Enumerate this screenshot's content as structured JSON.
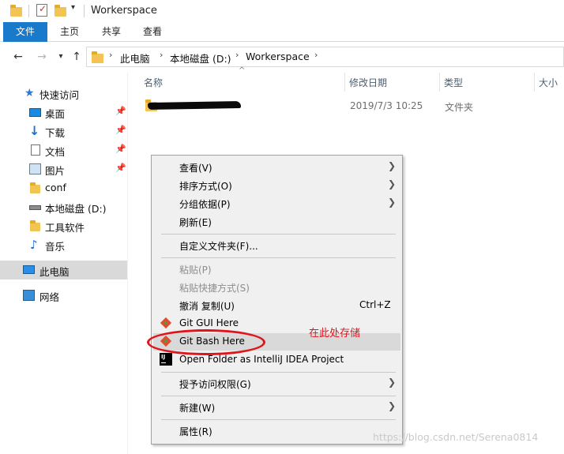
{
  "window": {
    "title": "Workerspace"
  },
  "ribbon": {
    "tabs": [
      "文件",
      "主页",
      "共享",
      "查看"
    ]
  },
  "address": {
    "back_icon": "arrow-left-icon",
    "forward_icon": "arrow-right-icon",
    "dropdown_icon": "chevron-down-icon",
    "up_icon": "arrow-up-icon",
    "crumbs": [
      "此电脑",
      "本地磁盘 (D:)",
      "Workerspace"
    ]
  },
  "sidebar": {
    "items": [
      {
        "label": "快速访问",
        "icon": "star-icon",
        "pinned": false,
        "selected": false
      },
      {
        "label": "桌面",
        "icon": "desktop-icon",
        "pinned": true,
        "selected": false
      },
      {
        "label": "下载",
        "icon": "download-icon",
        "pinned": true,
        "selected": false
      },
      {
        "label": "文档",
        "icon": "document-icon",
        "pinned": true,
        "selected": false
      },
      {
        "label": "图片",
        "icon": "picture-icon",
        "pinned": true,
        "selected": false
      },
      {
        "label": "conf",
        "icon": "folder-icon",
        "pinned": false,
        "selected": false
      },
      {
        "label": "本地磁盘 (D:)",
        "icon": "disk-icon",
        "pinned": false,
        "selected": false
      },
      {
        "label": "工具软件",
        "icon": "folder-icon",
        "pinned": false,
        "selected": false
      },
      {
        "label": "音乐",
        "icon": "music-icon",
        "pinned": false,
        "selected": false
      },
      {
        "label": "此电脑",
        "icon": "computer-icon",
        "pinned": false,
        "selected": true
      },
      {
        "label": "网络",
        "icon": "network-icon",
        "pinned": false,
        "selected": false
      }
    ]
  },
  "columns": [
    "名称",
    "修改日期",
    "类型",
    "大小"
  ],
  "files": [
    {
      "name_redacted": true,
      "date": "2019/7/3 10:25",
      "type": "文件夹"
    }
  ],
  "context_menu": {
    "items": [
      {
        "label": "查看(V)",
        "submenu": true
      },
      {
        "label": "排序方式(O)",
        "submenu": true
      },
      {
        "label": "分组依据(P)",
        "submenu": true
      },
      {
        "label": "刷新(E)"
      },
      {
        "separator": true
      },
      {
        "label": "自定义文件夹(F)..."
      },
      {
        "separator": true
      },
      {
        "label": "粘贴(P)",
        "disabled": true
      },
      {
        "label": "粘贴快捷方式(S)",
        "disabled": true
      },
      {
        "label": "撤消 复制(U)",
        "shortcut": "Ctrl+Z"
      },
      {
        "label": "Git GUI Here",
        "icon": "git-icon"
      },
      {
        "label": "Git Bash Here",
        "icon": "git-icon",
        "highlighted": true
      },
      {
        "label": "Open Folder as IntelliJ IDEA Project",
        "icon": "intellij-icon"
      },
      {
        "separator": true
      },
      {
        "label": "授予访问权限(G)",
        "submenu": true
      },
      {
        "separator": true
      },
      {
        "label": "新建(W)",
        "submenu": true
      },
      {
        "separator": true
      },
      {
        "label": "属性(R)"
      }
    ]
  },
  "annotation": {
    "text": "在此处存储",
    "color": "#e0141a"
  },
  "watermark": "https://blog.csdn.net/Serena0814"
}
